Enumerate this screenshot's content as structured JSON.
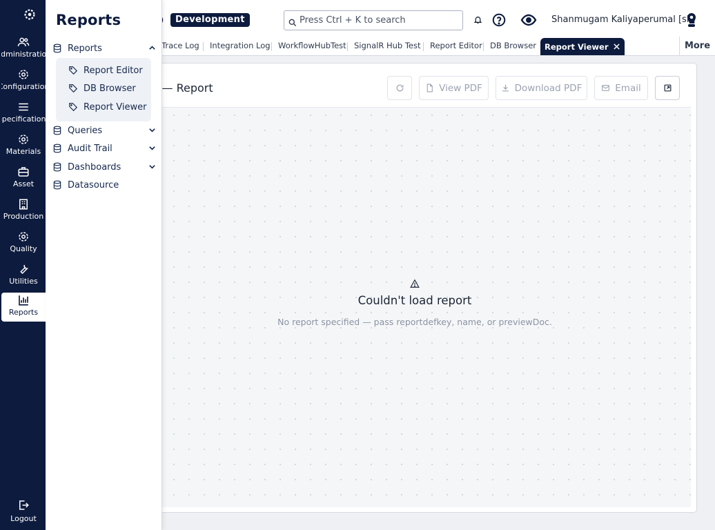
{
  "rail": {
    "items": [
      {
        "label": "Administration",
        "icon": "users-icon"
      },
      {
        "label": "Configuration",
        "icon": "gear-icon"
      },
      {
        "label": "Specifications",
        "icon": "list-icon"
      },
      {
        "label": "Materials",
        "icon": "gear-icon"
      },
      {
        "label": "Asset",
        "icon": "briefcase-icon"
      },
      {
        "label": "Production",
        "icon": "building-icon"
      },
      {
        "label": "Quality",
        "icon": "gear-icon"
      },
      {
        "label": "Utilities",
        "icon": "wrench-icon"
      },
      {
        "label": "Reports",
        "icon": "bar-chart-icon"
      }
    ],
    "logout_label": "Logout"
  },
  "flyout": {
    "title": "Reports",
    "sections": [
      {
        "label": "Reports",
        "expanded": true
      },
      {
        "label": "Queries",
        "expanded": false
      },
      {
        "label": "Audit Trail",
        "expanded": false
      },
      {
        "label": "Dashboards",
        "expanded": false
      },
      {
        "label": "Datasource",
        "expanded": false
      }
    ],
    "sub_items": [
      "Report Editor",
      "DB Browser",
      "Report Viewer"
    ]
  },
  "header": {
    "env_badge": "Development",
    "search_placeholder": "Press Ctrl + K to search",
    "user_name": "Shanmugam Kaliyaperumal [sk]"
  },
  "tabs": {
    "items": [
      "Trace Log",
      "Integration Log",
      "WorkflowHubTest",
      "SignalR Hub Test",
      "Report Editor",
      "DB Browser"
    ],
    "active": "Report Viewer",
    "more_label": "More"
  },
  "panel": {
    "title": "er — Report",
    "buttons": {
      "view_pdf": "View PDF",
      "download_pdf": "Download PDF",
      "email": "Email"
    },
    "error_title": "Couldn't load report",
    "error_message": "No report specified — pass reportdefkey, name, or previewDoc."
  },
  "colors": {
    "navy": "#0d1b3e",
    "background": "#eef0f4"
  }
}
